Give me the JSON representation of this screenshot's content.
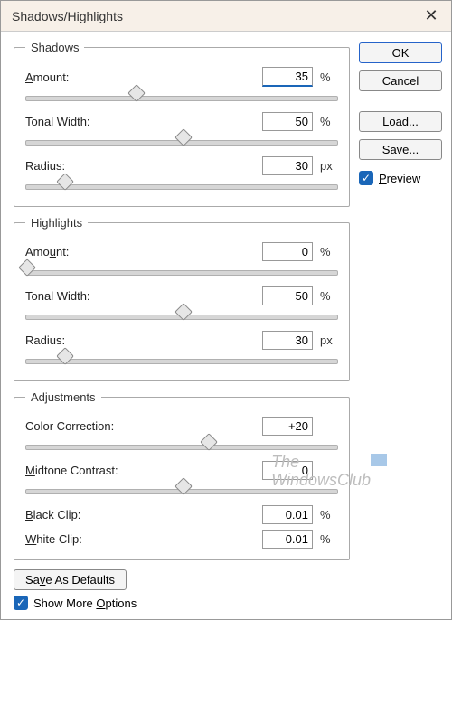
{
  "title": "Shadows/Highlights",
  "buttons": {
    "ok": "OK",
    "cancel": "Cancel",
    "load": "Load...",
    "save": "Save..."
  },
  "preview": {
    "label": "Preview",
    "checked": true
  },
  "groups": {
    "shadows": {
      "legend": "Shadows",
      "amount": {
        "label": "Amount:",
        "value": "35",
        "unit": "%",
        "pos": 35
      },
      "tonal_width": {
        "label": "Tonal Width:",
        "value": "50",
        "unit": "%",
        "pos": 50
      },
      "radius": {
        "label": "Radius:",
        "value": "30",
        "unit": "px",
        "pos": 12
      }
    },
    "highlights": {
      "legend": "Highlights",
      "amount": {
        "label": "Amount:",
        "value": "0",
        "unit": "%",
        "pos": 0
      },
      "tonal_width": {
        "label": "Tonal Width:",
        "value": "50",
        "unit": "%",
        "pos": 50
      },
      "radius": {
        "label": "Radius:",
        "value": "30",
        "unit": "px",
        "pos": 12
      }
    },
    "adjustments": {
      "legend": "Adjustments",
      "color_correction": {
        "label": "Color Correction:",
        "value": "+20",
        "unit": "",
        "pos": 58
      },
      "midtone_contrast": {
        "label": "Midtone Contrast:",
        "value": "0",
        "unit": "",
        "pos": 50
      },
      "black_clip": {
        "label": "Black Clip:",
        "value": "0.01",
        "unit": "%"
      },
      "white_clip": {
        "label": "White Clip:",
        "value": "0.01",
        "unit": "%"
      }
    }
  },
  "bottom": {
    "save_defaults": "Save As Defaults",
    "show_more": {
      "label": "Show More Options",
      "checked": true
    }
  },
  "watermark": {
    "l1": "The",
    "l2": "WindowsClub"
  }
}
